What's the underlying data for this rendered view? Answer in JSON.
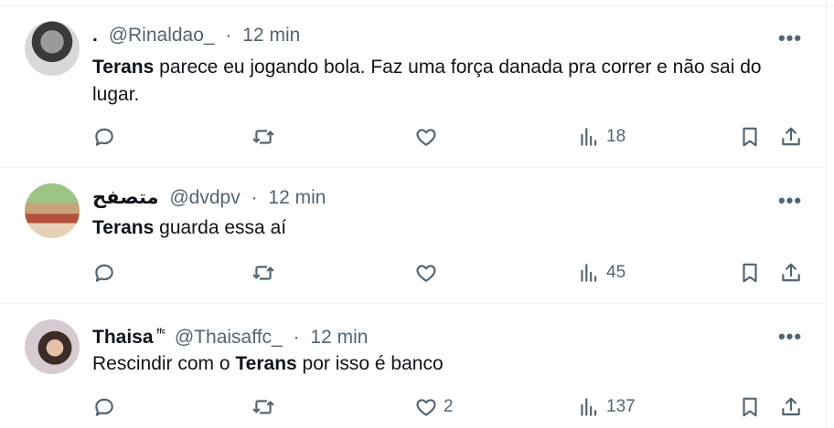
{
  "tweets": [
    {
      "display_name": ".",
      "handle": "@Rinaldao_",
      "separator": "·",
      "time": "12 min",
      "badge": "",
      "text_parts": {
        "before": "",
        "bold": "Terans",
        "after": " parece eu jogando bola. Faz uma força danada pra correr e não sai do lugar."
      },
      "likes": "",
      "views": "18"
    },
    {
      "display_name": "متصفح",
      "handle": "@dvdpv",
      "separator": "·",
      "time": "12 min",
      "badge": "",
      "text_parts": {
        "before": "",
        "bold": "Terans",
        "after": " guarda essa aí"
      },
      "likes": "",
      "views": "45"
    },
    {
      "display_name": "Thaisa",
      "handle": "@Thaisaffc_",
      "separator": "·",
      "time": "12 min",
      "badge": "ᶠᶠᶜ",
      "text_parts": {
        "before": "Rescindir com o ",
        "bold": "Terans",
        "after": " por isso é banco"
      },
      "likes": "2",
      "views": "137"
    }
  ],
  "icons": {
    "more": "more-horizontal-icon",
    "reply": "reply-icon",
    "retweet": "retweet-icon",
    "like": "heart-icon",
    "views": "analytics-icon",
    "bookmark": "bookmark-icon",
    "share": "share-icon"
  },
  "colors": {
    "text": "#0f1419",
    "muted": "#536471",
    "border": "#eff3f4"
  }
}
